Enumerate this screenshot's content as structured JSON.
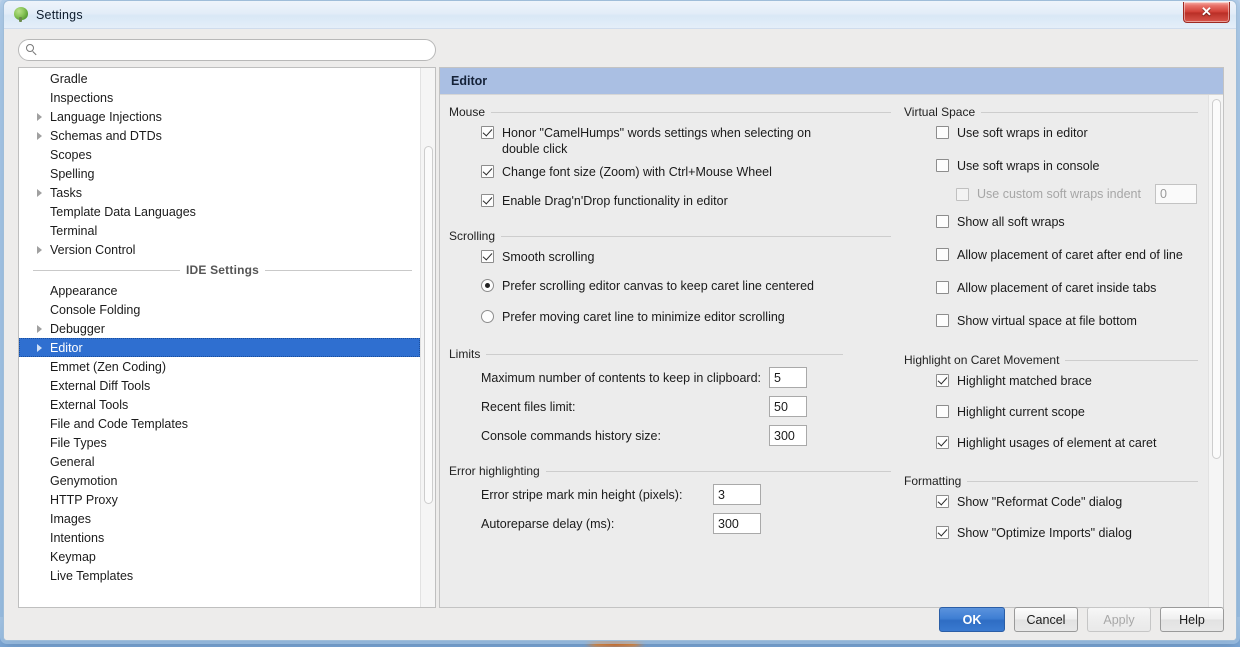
{
  "window": {
    "title": "Settings",
    "icon": "app-tree-icon",
    "close_label": "✕"
  },
  "search": {
    "value": "",
    "placeholder": "",
    "icon": "search-icon"
  },
  "sidebar": {
    "items": [
      {
        "label": "Gradle",
        "expandable": false,
        "selected": false
      },
      {
        "label": "Inspections",
        "expandable": false,
        "selected": false
      },
      {
        "label": "Language Injections",
        "expandable": true,
        "selected": false
      },
      {
        "label": "Schemas and DTDs",
        "expandable": true,
        "selected": false
      },
      {
        "label": "Scopes",
        "expandable": false,
        "selected": false
      },
      {
        "label": "Spelling",
        "expandable": false,
        "selected": false
      },
      {
        "label": "Tasks",
        "expandable": true,
        "selected": false
      },
      {
        "label": "Template Data Languages",
        "expandable": false,
        "selected": false
      },
      {
        "label": "Terminal",
        "expandable": false,
        "selected": false
      },
      {
        "label": "Version Control",
        "expandable": true,
        "selected": false
      }
    ],
    "separator_label": "IDE Settings",
    "ide_items": [
      {
        "label": "Appearance",
        "expandable": false,
        "selected": false
      },
      {
        "label": "Console Folding",
        "expandable": false,
        "selected": false
      },
      {
        "label": "Debugger",
        "expandable": true,
        "selected": false
      },
      {
        "label": "Editor",
        "expandable": true,
        "selected": true
      },
      {
        "label": "Emmet (Zen Coding)",
        "expandable": false,
        "selected": false
      },
      {
        "label": "External Diff Tools",
        "expandable": false,
        "selected": false
      },
      {
        "label": "External Tools",
        "expandable": false,
        "selected": false
      },
      {
        "label": "File and Code Templates",
        "expandable": false,
        "selected": false
      },
      {
        "label": "File Types",
        "expandable": false,
        "selected": false
      },
      {
        "label": "General",
        "expandable": false,
        "selected": false
      },
      {
        "label": "Genymotion",
        "expandable": false,
        "selected": false
      },
      {
        "label": "HTTP Proxy",
        "expandable": false,
        "selected": false
      },
      {
        "label": "Images",
        "expandable": false,
        "selected": false
      },
      {
        "label": "Intentions",
        "expandable": false,
        "selected": false
      },
      {
        "label": "Keymap",
        "expandable": false,
        "selected": false
      },
      {
        "label": "Live Templates",
        "expandable": false,
        "selected": false
      }
    ]
  },
  "panel": {
    "title": "Editor",
    "groups": {
      "mouse": {
        "title": "Mouse",
        "options": [
          {
            "label": "Honor \"CamelHumps\" words settings when selecting on double click",
            "checked": true
          },
          {
            "label": "Change font size (Zoom) with Ctrl+Mouse Wheel",
            "checked": true
          },
          {
            "label": "Enable Drag'n'Drop functionality in editor",
            "checked": true
          }
        ]
      },
      "scrolling": {
        "title": "Scrolling",
        "checkbox": {
          "label": "Smooth scrolling",
          "checked": true
        },
        "radios": [
          {
            "label": "Prefer scrolling editor canvas to keep caret line centered",
            "selected": true
          },
          {
            "label": "Prefer moving caret line to minimize editor scrolling",
            "selected": false
          }
        ]
      },
      "limits": {
        "title": "Limits",
        "fields": [
          {
            "label": "Maximum number of contents to keep in clipboard:",
            "value": "5"
          },
          {
            "label": "Recent files limit:",
            "value": "50"
          },
          {
            "label": "Console commands history size:",
            "value": "300"
          }
        ]
      },
      "error_highlighting": {
        "title": "Error highlighting",
        "fields": [
          {
            "label": "Error stripe mark min height (pixels):",
            "value": "3"
          },
          {
            "label": "Autoreparse delay (ms):",
            "value": "300"
          }
        ]
      },
      "virtual_space": {
        "title": "Virtual Space",
        "options": [
          {
            "label": "Use soft wraps in editor",
            "checked": false,
            "disabled": false
          },
          {
            "label": "Use soft wraps in console",
            "checked": false,
            "disabled": false
          }
        ],
        "indent_option": {
          "label": "Use custom soft wraps indent",
          "checked": false,
          "disabled": true,
          "value": "0"
        },
        "options_tail": [
          {
            "label": "Show all soft wraps",
            "checked": false,
            "disabled": false
          },
          {
            "label": "Allow placement of caret after end of line",
            "checked": false,
            "disabled": false
          },
          {
            "label": "Allow placement of caret inside tabs",
            "checked": false,
            "disabled": false
          },
          {
            "label": "Show virtual space at file bottom",
            "checked": false,
            "disabled": false
          }
        ]
      },
      "highlight_caret": {
        "title": "Highlight on Caret Movement",
        "options": [
          {
            "label": "Highlight matched brace",
            "checked": true
          },
          {
            "label": "Highlight current scope",
            "checked": false
          },
          {
            "label": "Highlight usages of element at caret",
            "checked": true
          }
        ]
      },
      "formatting": {
        "title": "Formatting",
        "options": [
          {
            "label": "Show \"Reformat Code\" dialog",
            "checked": true
          },
          {
            "label": "Show \"Optimize Imports\" dialog",
            "checked": true
          }
        ]
      }
    }
  },
  "buttons": {
    "ok": "OK",
    "cancel": "Cancel",
    "apply": "Apply",
    "help": "Help"
  }
}
